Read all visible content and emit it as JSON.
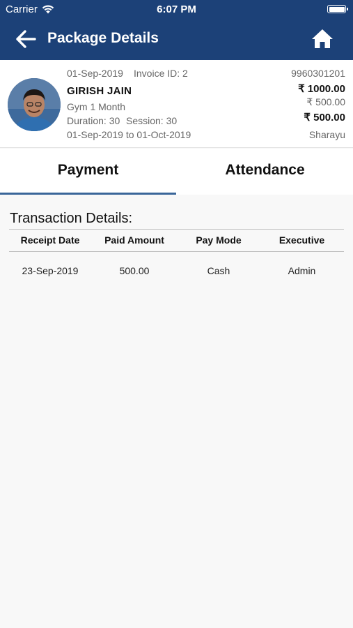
{
  "status_bar": {
    "carrier": "Carrier",
    "time": "6:07 PM",
    "wifi_icon": "wifi-icon",
    "battery_icon": "battery-icon"
  },
  "nav": {
    "title": "Package Details",
    "back_icon": "arrow-left-icon",
    "home_icon": "home-icon"
  },
  "package": {
    "date": "01-Sep-2019",
    "invoice": "Invoice ID: 2",
    "name": "GIRISH JAIN",
    "plan": "Gym 1 Month",
    "duration": "Duration: 30",
    "session": "Session: 30",
    "period": "01-Sep-2019 to 01-Oct-2019",
    "phone": "9960301201",
    "total": "₹  1000.00",
    "paid": "₹  500.00",
    "balance": "₹  500.00",
    "executive": "Sharayu"
  },
  "tabs": [
    {
      "label": "Payment",
      "active": true
    },
    {
      "label": "Attendance",
      "active": false
    }
  ],
  "transactions": {
    "title": "Transaction Details:",
    "headers": [
      "Receipt Date",
      "Paid Amount",
      "Pay Mode",
      "Executive"
    ],
    "rows": [
      [
        "23-Sep-2019",
        "500.00",
        "Cash",
        "Admin"
      ]
    ]
  },
  "colors": {
    "primary": "#1c4178",
    "tab_indicator": "#3a6699"
  }
}
